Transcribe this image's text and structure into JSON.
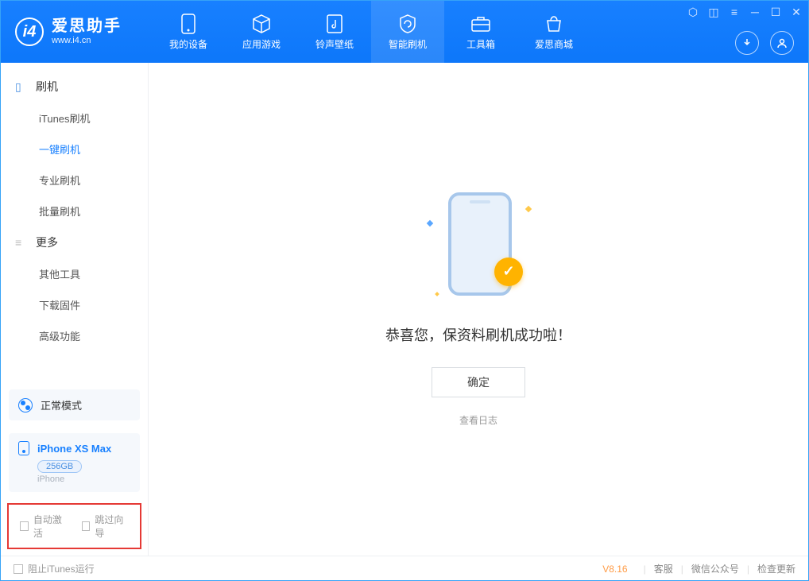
{
  "header": {
    "logo_title": "爱思助手",
    "logo_sub": "www.i4.cn",
    "tabs": [
      {
        "label": "我的设备",
        "icon": "device-icon"
      },
      {
        "label": "应用游戏",
        "icon": "cube-icon"
      },
      {
        "label": "铃声壁纸",
        "icon": "music-note-icon"
      },
      {
        "label": "智能刷机",
        "icon": "refresh-shield-icon",
        "active": true
      },
      {
        "label": "工具箱",
        "icon": "toolbox-icon"
      },
      {
        "label": "爱思商城",
        "icon": "shop-icon"
      }
    ],
    "right_buttons": [
      "download-icon",
      "user-icon"
    ],
    "window_controls": [
      "shirt-icon",
      "rss-icon",
      "menu-icon",
      "minimize-icon",
      "maximize-icon",
      "close-icon"
    ]
  },
  "sidebar": {
    "group1": {
      "title": "刷机",
      "items": [
        "iTunes刷机",
        "一键刷机",
        "专业刷机",
        "批量刷机"
      ],
      "active_index": 1
    },
    "group2": {
      "title": "更多",
      "items": [
        "其他工具",
        "下载固件",
        "高级功能"
      ]
    },
    "mode_label": "正常模式",
    "device": {
      "name": "iPhone XS Max",
      "capacity": "256GB",
      "type": "iPhone"
    },
    "checkboxes": {
      "auto_activate": "自动激活",
      "skip_guide": "跳过向导"
    }
  },
  "main": {
    "success_text": "恭喜您，保资料刷机成功啦！",
    "ok_button": "确定",
    "log_link": "查看日志"
  },
  "footer": {
    "block_itunes": "阻止iTunes运行",
    "version": "V8.16",
    "links": [
      "客服",
      "微信公众号",
      "检查更新"
    ]
  }
}
